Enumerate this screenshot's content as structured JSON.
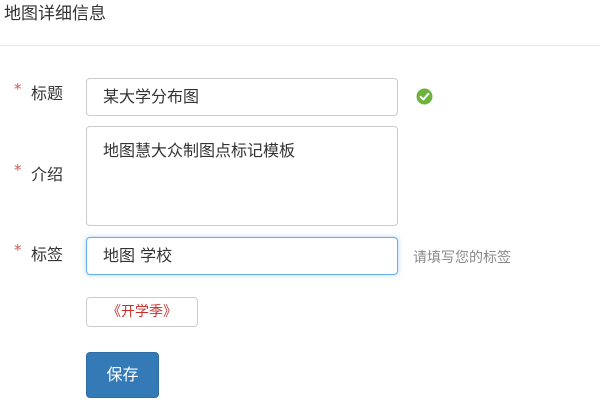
{
  "header": {
    "title": "地图详细信息"
  },
  "form": {
    "required_mark": "*",
    "title_field": {
      "label": "标题",
      "value": "某大学分布图",
      "valid_icon": "check-circle-icon",
      "valid_color": "#6cb33e"
    },
    "intro_field": {
      "label": "介绍",
      "value": "地图慧大众制图点标记模板"
    },
    "tags_field": {
      "label": "标签",
      "value": "地图 学校",
      "help": "请填写您的标签"
    },
    "suggested_tags": [
      "《开学季》"
    ],
    "save_label": "保存"
  },
  "colors": {
    "required": "#d9534f",
    "primary": "#337ab7",
    "focus_border": "#66afe9",
    "tag_text": "#c9302c"
  }
}
